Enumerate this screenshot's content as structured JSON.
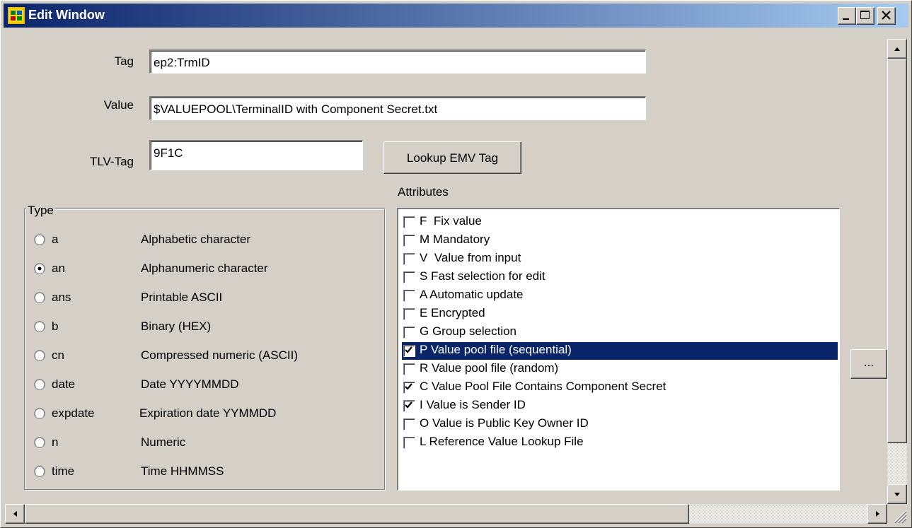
{
  "window": {
    "title": "Edit Window"
  },
  "fields": {
    "tag": {
      "label": "Tag",
      "value": "ep2:TrmID"
    },
    "value": {
      "label": "Value",
      "value": "$VALUEPOOL\\TerminalID with Component Secret.txt"
    },
    "tlv": {
      "label": "TLV-Tag",
      "value": "9F1C"
    }
  },
  "buttons": {
    "lookup": "Lookup EMV Tag",
    "ellipsis": "..."
  },
  "type_group": {
    "title": "Type",
    "selected": "an",
    "options": [
      {
        "code": "a",
        "desc": "Alphabetic character",
        "selected": false
      },
      {
        "code": "an",
        "desc": "Alphanumeric character",
        "selected": true
      },
      {
        "code": "ans",
        "desc": "Printable ASCII",
        "selected": false
      },
      {
        "code": "b",
        "desc": "Binary (HEX)",
        "selected": false
      },
      {
        "code": "cn",
        "desc": "Compressed numeric (ASCII)",
        "selected": false
      },
      {
        "code": "date",
        "desc": "Date YYYYMMDD",
        "selected": false
      },
      {
        "code": "expdate",
        "desc": "Expiration date YYMMDD",
        "selected": false
      },
      {
        "code": "n",
        "desc": "Numeric",
        "selected": false
      },
      {
        "code": "time",
        "desc": "Time HHMMSS",
        "selected": false
      }
    ]
  },
  "attributes": {
    "caption": "Attributes",
    "items": [
      {
        "label": "F  Fix value",
        "checked": false,
        "selected": false
      },
      {
        "label": "M Mandatory",
        "checked": false,
        "selected": false
      },
      {
        "label": "V  Value from input",
        "checked": false,
        "selected": false
      },
      {
        "label": "S Fast selection for edit",
        "checked": false,
        "selected": false
      },
      {
        "label": "A Automatic update",
        "checked": false,
        "selected": false
      },
      {
        "label": "E Encrypted",
        "checked": false,
        "selected": false
      },
      {
        "label": "G Group selection",
        "checked": false,
        "selected": false
      },
      {
        "label": "P Value pool file (sequential)",
        "checked": true,
        "selected": true
      },
      {
        "label": "R Value pool file (random)",
        "checked": false,
        "selected": false
      },
      {
        "label": "C Value Pool File Contains Component Secret",
        "checked": true,
        "selected": false
      },
      {
        "label": "I Value is Sender ID",
        "checked": true,
        "selected": false
      },
      {
        "label": "O Value is Public Key Owner ID",
        "checked": false,
        "selected": false
      },
      {
        "label": "L Reference Value Lookup File",
        "checked": false,
        "selected": false
      }
    ]
  },
  "colors": {
    "title_start": "#0a246a",
    "title_end": "#a6caf0",
    "face": "#d4d0c8",
    "selection": "#0a246a"
  },
  "icons": [
    "app-icon",
    "minimize-icon",
    "maximize-icon",
    "close-icon",
    "radio-icon",
    "checkbox-icon",
    "scroll-up-icon",
    "scroll-down-icon",
    "scroll-left-icon",
    "scroll-right-icon",
    "resize-grip-icon"
  ]
}
